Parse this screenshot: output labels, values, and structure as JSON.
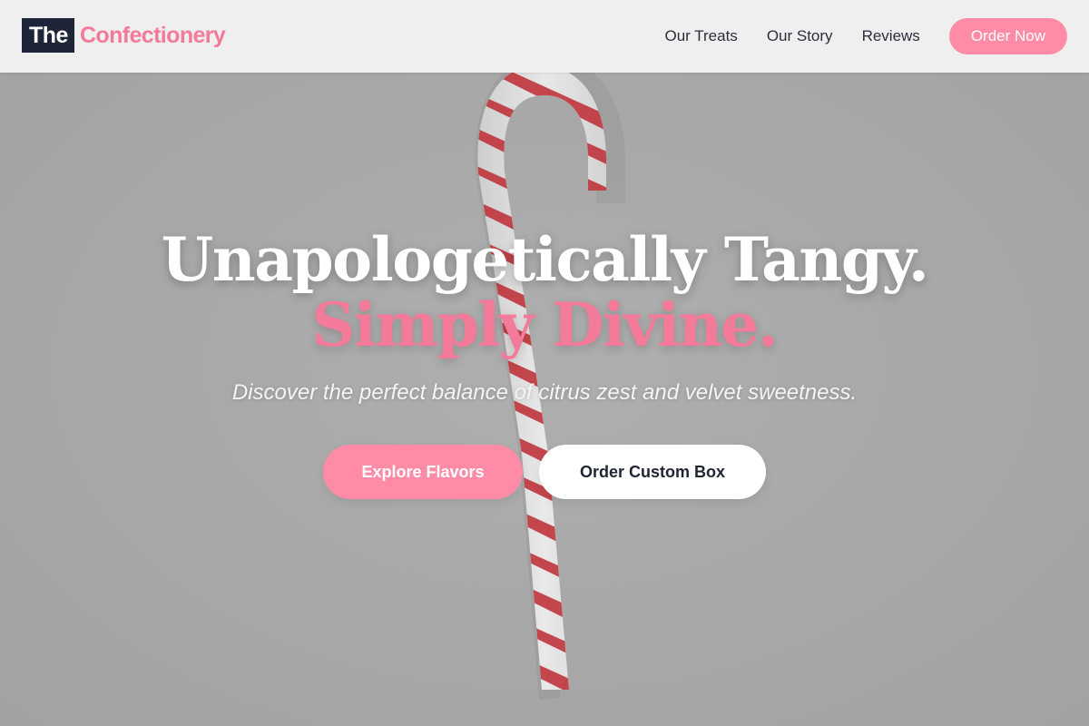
{
  "brand": {
    "logo_box_text": "The",
    "logo_name": "Confectionery"
  },
  "nav": {
    "links": [
      "Our Treats",
      "Our Story",
      "Reviews"
    ],
    "cta_label": "Order Now"
  },
  "hero": {
    "headline_line1": "Unapologetically Tangy.",
    "headline_line2": "Simply Divine.",
    "tagline": "Discover the perfect balance of citrus zest and velvet sweetness.",
    "primary_button": "Explore Flavors",
    "secondary_button": "Order Custom Box",
    "background_image": "candy-cane"
  },
  "colors": {
    "brand_pink": "#f47a99",
    "button_pink": "#ff8ba6",
    "navy": "#1e2538",
    "header_bg": "#efefef",
    "hero_bg": "#adadad",
    "candy_red": "#c8242b"
  }
}
